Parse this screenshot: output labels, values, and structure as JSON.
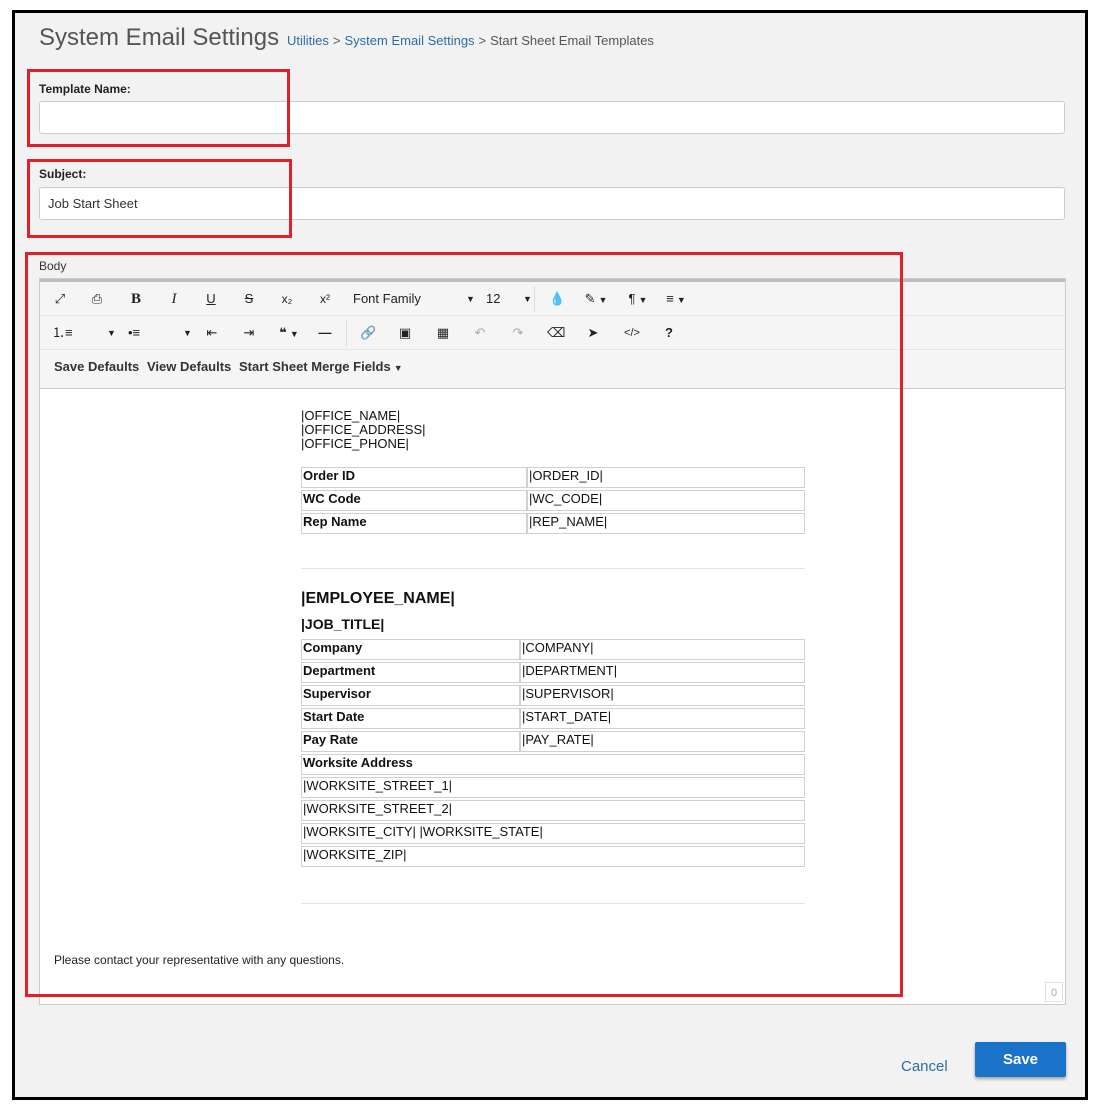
{
  "header": {
    "title": "System Email Settings",
    "breadcrumb": [
      {
        "label": "Utilities",
        "link": true
      },
      {
        "label": "System Email Settings",
        "link": true
      },
      {
        "label": "Start Sheet Email Templates",
        "link": false
      }
    ],
    "separator": ">"
  },
  "form": {
    "template_name": {
      "label": "Template Name:",
      "value": ""
    },
    "subject": {
      "label": "Subject:",
      "value": "Job Start Sheet"
    },
    "body_label": "Body"
  },
  "toolbar": {
    "font_family": "Font Family",
    "font_size": "12",
    "buttons_row3": [
      "Save Defaults",
      "View Defaults",
      "Start Sheet Merge Fields"
    ]
  },
  "content": {
    "office": [
      "|OFFICE_NAME|",
      "|OFFICE_ADDRESS|",
      "|OFFICE_PHONE|"
    ],
    "order_table": [
      [
        "Order ID",
        "|ORDER_ID|"
      ],
      [
        "WC Code",
        "|WC_CODE|"
      ],
      [
        "Rep Name",
        "|REP_NAME|"
      ]
    ],
    "employee_name": "|EMPLOYEE_NAME|",
    "job_title": "|JOB_TITLE|",
    "employee_table": [
      [
        "Company",
        "|COMPANY|"
      ],
      [
        "Department",
        "|DEPARTMENT|"
      ],
      [
        "Supervisor",
        "|SUPERVISOR|"
      ],
      [
        "Start Date",
        "|START_DATE|"
      ],
      [
        "Pay Rate",
        "|PAY_RATE|"
      ]
    ],
    "worksite_heading": "Worksite Address",
    "worksite_lines": [
      "|WORKSITE_STREET_1|",
      "|WORKSITE_STREET_2|",
      "|WORKSITE_CITY| |WORKSITE_STATE|",
      "|WORKSITE_ZIP|"
    ],
    "footer_note": "Please contact your representative with any questions.",
    "char_count": "0"
  },
  "actions": {
    "cancel": "Cancel",
    "save": "Save"
  },
  "colors": {
    "accent": "#1a73c8",
    "link": "#2e6da4",
    "highlight": "#e0202a"
  }
}
